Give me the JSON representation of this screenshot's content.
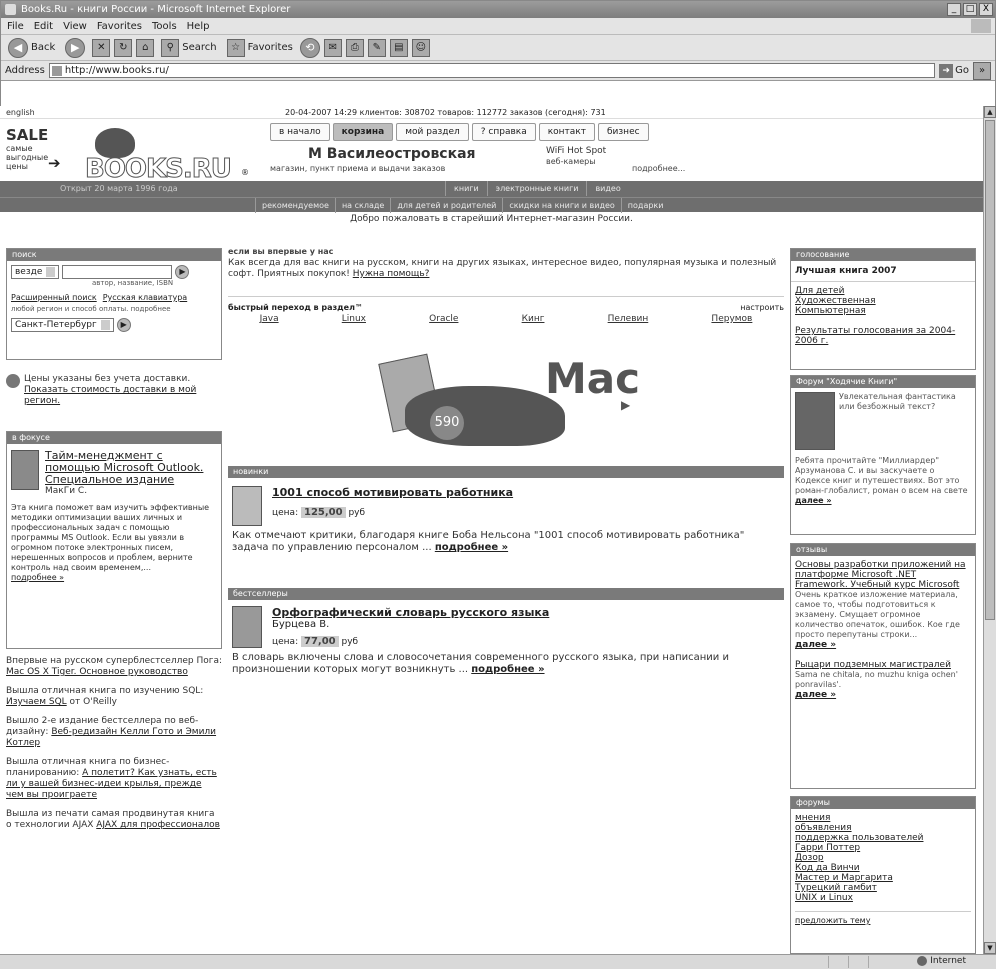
{
  "window": {
    "title": "Books.Ru - книги России - Microsoft Internet Explorer",
    "controls": [
      "_",
      "□",
      "X"
    ]
  },
  "menu": [
    "File",
    "Edit",
    "View",
    "Favorites",
    "Tools",
    "Help"
  ],
  "toolbar": {
    "back": "Back",
    "search": "Search",
    "favorites": "Favorites"
  },
  "address": {
    "label": "Address",
    "url": "http://www.books.ru/",
    "go": "Go"
  },
  "status": {
    "zone": "Internet"
  },
  "page": {
    "lang_link": "english",
    "stats": "20-04-2007 14:29   клиентов: 308702   товаров: 112772   заказов (сегодня): 731",
    "sale": {
      "title": "SALE",
      "text": "самые выгодные цены"
    },
    "logo": "BOOKS.RU",
    "tagline": "Открыт 20 марта 1996 года",
    "nav_tabs": [
      "в начало",
      "корзина",
      "мой раздел",
      "? справка",
      "контакт",
      "бизнес"
    ],
    "promo": {
      "name": "М Василеостровская",
      "sub": "магазин, пункт приема и выдачи заказов",
      "wifi": "WiFi Hot Spot",
      "wifi_sub": "веб-камеры",
      "more": "подробнее..."
    },
    "bar1": [
      "книги",
      "электронные книги",
      "видео"
    ],
    "bar2": [
      "рекомендуемое",
      "на складе",
      "для детей и родителей",
      "скидки на книги и видео",
      "подарки"
    ],
    "welcome": "Добро пожаловать в старейший Интернет-магазин России."
  },
  "left": {
    "search": {
      "header": "поиск",
      "scope": "везде",
      "hint": "автор, название, ISBN",
      "advanced": "Расширенный поиск",
      "russian": "Русская клавиатура",
      "region_note": "любой регион и способ оплаты. подробнее",
      "city": "Санкт-Петербург"
    },
    "delivery": {
      "text": "Цены указаны без учета доставки.",
      "link": "Показать стоимость доставки в мой регион."
    },
    "focus": {
      "header": "в фокусе",
      "title": "Тайм-менеджмент с помощью Microsoft Outlook. Специальное издание",
      "author": "МакГи С.",
      "desc": "Эта книга поможет вам изучить эффективные методики оптимизации ваших личных и профессиональных задач с помощью программы MS Outlook. Если вы увязли в огромном потоке электронных писем, нерешенных вопросов и проблем, верните контроль над своим временем,...",
      "more": "подробнее »"
    },
    "news": [
      {
        "text": "Впервые на русском суперблестселлер Пога: ",
        "link": "Mac OS X Tiger. Основное руководство"
      },
      {
        "text": "Вышла отличная книга по изучению SQL: ",
        "link": "Изучаем SQL",
        "tail": " от O'Reilly"
      },
      {
        "text": "Вышло 2-е издание бестселлера по веб-дизайну: ",
        "link": "Веб-редизайн Келли Гото и Эмили Котлер"
      },
      {
        "text": "Вышла отличная книга по бизнес-планированию: ",
        "link": "А полетит? Как узнать, есть ли у вашей бизнес-идеи крылья, прежде чем вы проиграете"
      },
      {
        "text": "Вышла из печати самая продвинутая книга о технологии AJAX ",
        "link": "AJAX для профессионалов"
      }
    ]
  },
  "center": {
    "first_time": {
      "header": "если вы впервые у нас",
      "text": "Как всегда для вас книги на русском, книги на других языках, интересное видео, популярная музыка и полезный софт. Приятных покупок! ",
      "link": "Нужна помощь?"
    },
    "quick": {
      "label": "быстрый переход в раздел™",
      "settings": "настроить",
      "links": [
        "Java",
        "Linux",
        "Oracle",
        "Кинг",
        "Пелевин",
        "Перумов"
      ]
    },
    "banner": {
      "title": "Mac",
      "price": "590"
    },
    "novelty": {
      "header": "новинки",
      "title": "1001 способ мотивировать работника",
      "price_label": "цена:",
      "price": "125,00",
      "currency": "руб",
      "desc": "Как отмечают критики, благодаря книге Боба Нельсона \"1001 способ мотивировать работника\" задача по управлению персоналом ... ",
      "more": "подробнее »"
    },
    "bestseller": {
      "header": "бестселлеры",
      "title": "Орфографический словарь русского языка",
      "author": "Бурцева В.",
      "price_label": "цена:",
      "price": "77,00",
      "currency": "руб",
      "desc": "В словарь включены слова и словосочетания современного русского языка, при написании и произношении которых могут возникнуть ... ",
      "more": "подробнее »"
    }
  },
  "right": {
    "voting": {
      "header": "голосование",
      "subtitle": "Лучшая книга 2007",
      "links": [
        "Для детей",
        "Художественная",
        "Компьютерная"
      ],
      "results": "Результаты голосования за 2004-2006 г."
    },
    "forum": {
      "header": "Форум \"Ходячие Книги\"",
      "teaser": "Увлекательная фантастика или безбожный текст?",
      "text": "Ребята прочитайте \"Миллиардер\" Арзуманова С. и вы заскучаете о Кодексе книг и путешествиях. Вот это роман-глобалист, роман о всем на свете ",
      "more": "далее »"
    },
    "reviews": {
      "header": "отзывы",
      "title1": "Основы разработки приложений на платформе Microsoft .NET Framework. Учебный курс Microsoft",
      "text1": "Очень краткое изложение материала, самое то, чтобы подготовиться к экзамену. Смущает огромное количество опечаток, ошибок. Кое где просто перепутаны строки...",
      "more1": "далее »",
      "title2": "Рыцари подземных магистралей",
      "text2": "Sama ne chitala, no muzhu kniga ochen' ponravilas'.",
      "more2": "далее »"
    },
    "forums": {
      "header": "форумы",
      "links": [
        "мнения",
        "объявления",
        "поддержка пользователей",
        "Гарри Поттер",
        "Дозор",
        "Код да Винчи",
        "Мастер и Маргарита",
        "Турецкий гамбит",
        "UNIX и Linux"
      ],
      "suggest": "предложить тему"
    }
  }
}
